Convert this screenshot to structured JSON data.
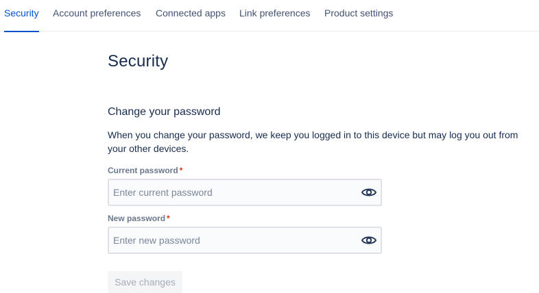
{
  "tabs": [
    {
      "label": "Security",
      "active": true
    },
    {
      "label": "Account preferences",
      "active": false
    },
    {
      "label": "Connected apps",
      "active": false
    },
    {
      "label": "Link preferences",
      "active": false
    },
    {
      "label": "Product settings",
      "active": false
    }
  ],
  "page": {
    "title": "Security"
  },
  "password_section": {
    "title": "Change your password",
    "description": "When you change your password, we keep you logged in to this device but may log you out from your other devices.",
    "current_password": {
      "label": "Current password",
      "required_marker": "*",
      "placeholder": "Enter current password",
      "value": "",
      "toggle_icon": "eye-icon"
    },
    "new_password": {
      "label": "New password",
      "required_marker": "*",
      "placeholder": "Enter new password",
      "value": "",
      "toggle_icon": "eye-icon"
    },
    "save_button": {
      "label": "Save changes",
      "disabled": true
    }
  },
  "colors": {
    "accent": "#0052cc",
    "text": "#172b4d",
    "muted": "#6b778c",
    "required": "#de350b",
    "input_border": "#dfe1e6",
    "input_bg": "#fafbfc"
  }
}
